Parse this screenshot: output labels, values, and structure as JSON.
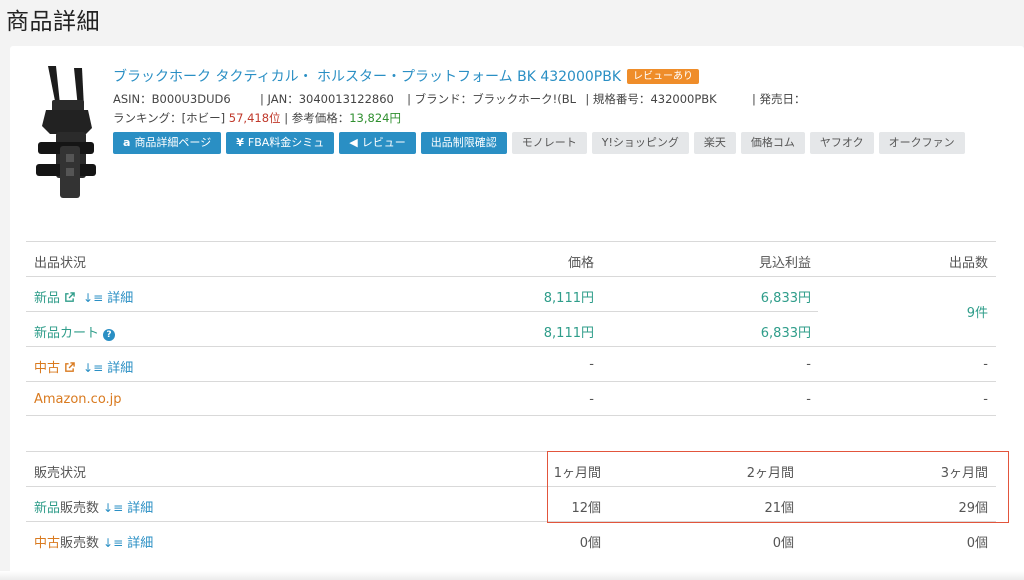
{
  "page": {
    "title": "商品詳細"
  },
  "product": {
    "title": "ブラックホーク タクティカル・ ホルスター・プラットフォーム BK 432000PBK",
    "badge": "レビューあり",
    "asin_label": "ASIN：",
    "asin": "B000U3DUD6",
    "jan_label": "| JAN：",
    "jan": "3040013122860",
    "brand_label": "| ブランド：",
    "brand": "ブラックホーク!(BL",
    "model_label": "| 規格番号：",
    "model": "432000PBK",
    "release_label": "| 発売日：",
    "release": "",
    "ranking_label": "ランキング：[ホビー]",
    "ranking": "57,418位",
    "ref_price_label": "| 参考価格：",
    "ref_price": "13,824円"
  },
  "buttons": [
    {
      "label": "商品詳細ページ",
      "icon": "a",
      "style": "blue"
    },
    {
      "label": "FBA料金シミュ",
      "icon": "¥",
      "style": "blue"
    },
    {
      "label": "レビュー",
      "icon": "📢",
      "style": "blue"
    },
    {
      "label": "出品制限確認",
      "icon": "",
      "style": "blue"
    },
    {
      "label": "モノレート",
      "icon": "",
      "style": "gray"
    },
    {
      "label": "Y!ショッピング",
      "icon": "",
      "style": "gray"
    },
    {
      "label": "楽天",
      "icon": "",
      "style": "gray"
    },
    {
      "label": "価格コム",
      "icon": "",
      "style": "gray"
    },
    {
      "label": "ヤフオク",
      "icon": "",
      "style": "gray"
    },
    {
      "label": "オークファン",
      "icon": "",
      "style": "gray"
    }
  ],
  "listing": {
    "headers": [
      "出品状況",
      "価格",
      "見込利益",
      "出品数"
    ],
    "rows": [
      {
        "label": "新品",
        "detail": "詳細",
        "price": "8,111円",
        "profit": "6,833円"
      },
      {
        "label": "新品カート",
        "price": "8,111円",
        "profit": "6,833円"
      },
      {
        "label": "中古",
        "detail": "詳細",
        "price": "-",
        "profit": "-",
        "count": "-"
      },
      {
        "label": "Amazon.co.jp",
        "price": "-",
        "profit": "-",
        "count": "-"
      }
    ],
    "new_count": "9件"
  },
  "sales": {
    "headers": [
      "販売状況",
      "1ヶ月間",
      "2ヶ月間",
      "3ヶ月間"
    ],
    "rows": [
      {
        "prefix": "新品",
        "label": "販売数",
        "detail": "詳細",
        "m1": "12個",
        "m2": "21個",
        "m3": "29個"
      },
      {
        "prefix": "中古",
        "label": "販売数",
        "detail": "詳細",
        "m1": "0個",
        "m2": "0個",
        "m3": "0個"
      }
    ]
  },
  "colors": {
    "accent": "#2a8fc4",
    "new": "#2f9d8a",
    "used": "#d97a1f",
    "badge": "#ef8d2a",
    "highlight": "#e2553c"
  }
}
